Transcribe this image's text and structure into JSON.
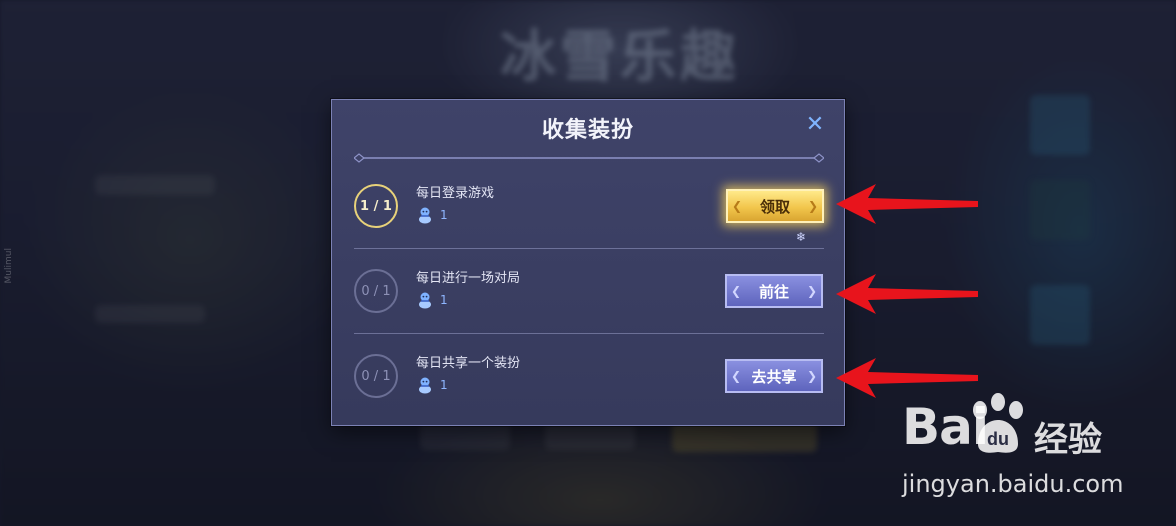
{
  "background": {
    "banner_text": "冰雪乐趣",
    "side_text": "Mulimul"
  },
  "dialog": {
    "title": "收集装扮",
    "close_icon": "close-icon",
    "tasks": [
      {
        "progress": "1 / 1",
        "name": "每日登录游戏",
        "reward_icon": "snowman-icon",
        "reward_count": "1",
        "action": "领取",
        "state": "claimable"
      },
      {
        "progress": "0 / 1",
        "name": "每日进行一场对局",
        "reward_icon": "snowman-icon",
        "reward_count": "1",
        "action": "前往",
        "state": "pending"
      },
      {
        "progress": "0 / 1",
        "name": "每日共享一个装扮",
        "reward_icon": "snowman-icon",
        "reward_count": "1",
        "action": "去共享",
        "state": "pending"
      }
    ]
  },
  "watermark": {
    "logo": "Bai",
    "logo_cn": "经验",
    "url": "jingyan.baidu.com"
  },
  "colors": {
    "dialog_bg": "#3f4369",
    "claim_gold": "#f2c64c",
    "go_blue": "#5e64bd",
    "arrow_red": "#e8141c"
  }
}
